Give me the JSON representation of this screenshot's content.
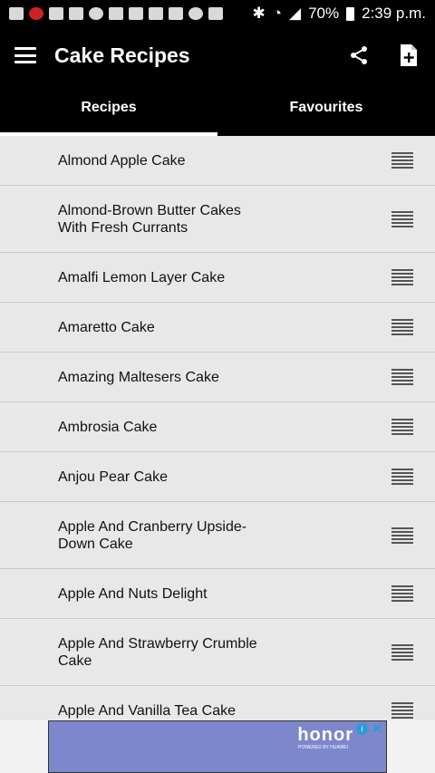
{
  "status_bar": {
    "battery": "70%",
    "time": "2:39 p.m."
  },
  "app_bar": {
    "title": "Cake Recipes"
  },
  "tabs": [
    {
      "label": "Recipes",
      "active": true
    },
    {
      "label": "Favourites",
      "active": false
    }
  ],
  "recipes": [
    {
      "lines": [
        "Almond Apple Cake"
      ]
    },
    {
      "lines": [
        "Almond-Brown Butter Cakes",
        "With Fresh Currants"
      ]
    },
    {
      "lines": [
        "Amalfi Lemon Layer Cake"
      ]
    },
    {
      "lines": [
        "Amaretto Cake"
      ]
    },
    {
      "lines": [
        "Amazing Maltesers Cake"
      ]
    },
    {
      "lines": [
        "Ambrosia Cake"
      ]
    },
    {
      "lines": [
        "Anjou Pear Cake"
      ]
    },
    {
      "lines": [
        "Apple And Cranberry Upside-",
        "Down Cake"
      ]
    },
    {
      "lines": [
        "Apple And Nuts Delight"
      ]
    },
    {
      "lines": [
        "Apple And Strawberry Crumble",
        "Cake"
      ]
    },
    {
      "lines": [
        "Apple And Vanilla Tea Cake"
      ]
    }
  ],
  "ad": {
    "brand": "honor",
    "sub": "POWERED BY HUAWEI",
    "info": "i",
    "close": "✕"
  }
}
